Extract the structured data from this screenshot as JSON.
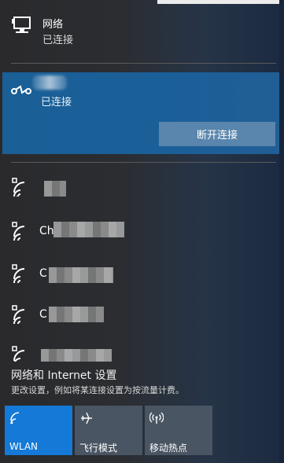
{
  "wired": {
    "icon": "ethernet-monitor-icon",
    "name": "网络",
    "status": "已连接"
  },
  "vpn": {
    "icon": "vpn-link-icon",
    "status": "已连接",
    "disconnect_label": "断开连接"
  },
  "wifi": [
    {
      "name": "",
      "icon": "wifi-secured-icon"
    },
    {
      "name": "Ch",
      "icon": "wifi-secured-icon"
    },
    {
      "name": "C",
      "icon": "wifi-secured-icon"
    },
    {
      "name": "C",
      "icon": "wifi-secured-icon"
    },
    {
      "name": "",
      "icon": "wifi-secured-icon"
    }
  ],
  "settings": {
    "title": "网络和 Internet 设置",
    "description": "更改设置，例如将某连接设置为按流量计费。"
  },
  "quick_actions": [
    {
      "label": "WLAN",
      "icon": "wifi-icon",
      "active": true
    },
    {
      "label": "飞行模式",
      "icon": "airplane-icon",
      "active": false
    },
    {
      "label": "移动热点",
      "icon": "hotspot-icon",
      "active": false
    }
  ],
  "colors": {
    "accent": "#1479d7",
    "selected_bg": "#1b5f99",
    "button_bg": "#5a85ac",
    "tile_bg": "#4a5563"
  }
}
